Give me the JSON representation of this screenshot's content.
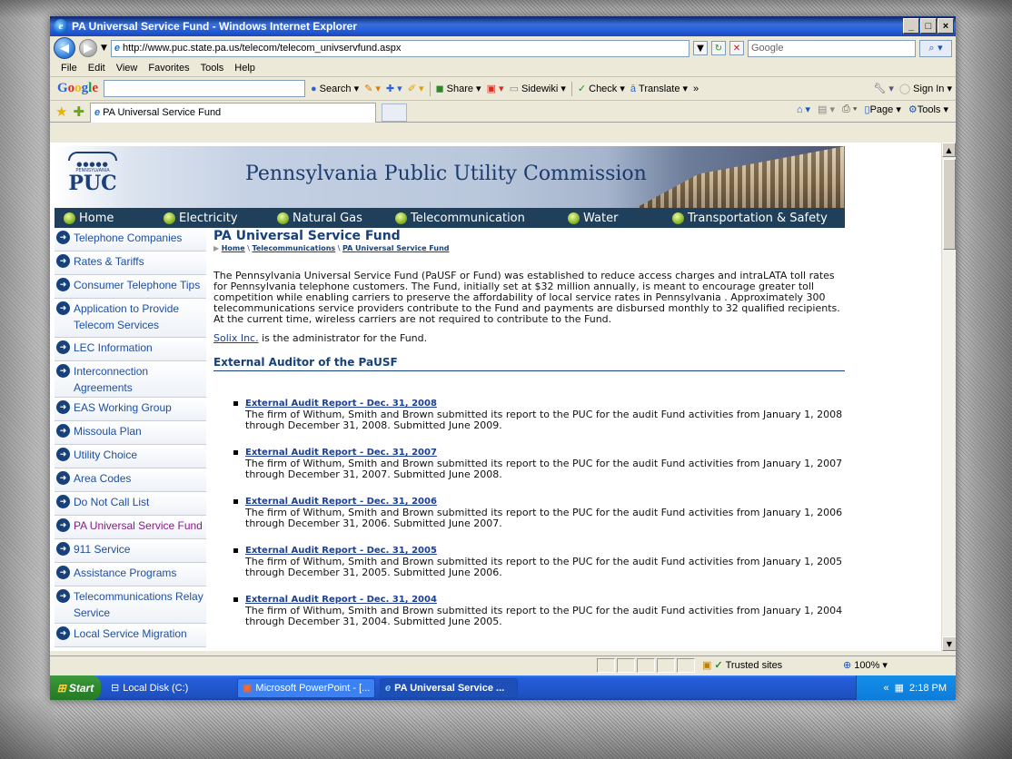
{
  "window": {
    "title": "PA Universal Service Fund - Windows Internet Explorer",
    "controls": [
      "_",
      "□",
      "×"
    ]
  },
  "address_bar": {
    "url": "http://www.puc.state.pa.us/telecom/telecom_univservfund.aspx",
    "search_placeholder": "Google"
  },
  "menu": [
    "File",
    "Edit",
    "View",
    "Favorites",
    "Tools",
    "Help"
  ],
  "google_toolbar": {
    "logo": "Google",
    "items": [
      "Search ▾",
      "Share ▾",
      "Sidewiki ▾",
      "Check ▾",
      "Translate ▾",
      "»"
    ],
    "sign_in": "Sign In ▾"
  },
  "tab": {
    "title": "PA Universal Service Fund",
    "tools": [
      "Page ▾",
      "Tools ▾"
    ]
  },
  "site": {
    "title": "Pennsylvania Public Utility Commission",
    "logo_text": "PUC",
    "logo_state": "PENNSYLVANIA"
  },
  "topnav": [
    "Home",
    "Electricity",
    "Natural Gas",
    "Telecommunication",
    "Water",
    "Transportation & Safety"
  ],
  "sidebar": [
    {
      "label": "Telephone Companies",
      "active": false
    },
    {
      "label": "Rates & Tariffs",
      "active": false
    },
    {
      "label": "Consumer Telephone Tips",
      "active": false
    },
    {
      "label": "Application to Provide Telecom Services",
      "active": false
    },
    {
      "label": "LEC Information",
      "active": false
    },
    {
      "label": "Interconnection Agreements",
      "active": false
    },
    {
      "label": "EAS Working Group",
      "active": false
    },
    {
      "label": "Missoula Plan",
      "active": false
    },
    {
      "label": "Utility Choice",
      "active": false
    },
    {
      "label": "Area Codes",
      "active": false
    },
    {
      "label": "Do Not Call List",
      "active": false
    },
    {
      "label": "PA Universal Service Fund",
      "active": true
    },
    {
      "label": "911 Service",
      "active": false
    },
    {
      "label": "Assistance Programs",
      "active": false
    },
    {
      "label": "Telecommunications Relay Service",
      "active": false
    },
    {
      "label": "Local Service Migration",
      "active": false
    }
  ],
  "main": {
    "heading": "PA Universal Service Fund",
    "breadcrumb": [
      "Home",
      "Telecommunications",
      "PA Universal Service Fund"
    ],
    "intro": "The Pennsylvania Universal Service Fund (PaUSF or Fund) was established to reduce access charges and intraLATA toll rates for Pennsylvania telephone customers. The Fund, initially set at $32 million annually, is meant to encourage greater toll competition while enabling carriers to preserve the affordability of local service rates in Pennsylvania . Approximately 300 telecommunications service providers contribute to the Fund and payments are disbursed monthly to 32 qualified recipients. At the current time, wireless carriers are not required to contribute to the Fund.",
    "admin_link": "Solix Inc.",
    "admin_text": " is the administrator for the Fund.",
    "section_heading": "External Auditor of the PaUSF",
    "reports": [
      {
        "title": "External Audit Report - Dec. 31, 2008",
        "text": "The firm of Withum, Smith and Brown submitted its report to the PUC for the audit Fund activities from January 1, 2008 through December 31, 2008. Submitted June 2009."
      },
      {
        "title": "External Audit Report - Dec. 31, 2007",
        "text": "The firm of Withum, Smith and Brown submitted its report to the PUC for the audit Fund activities from January 1, 2007 through December 31, 2007. Submitted June 2008."
      },
      {
        "title": "External Audit Report - Dec. 31, 2006",
        "text": "The firm of Withum, Smith and Brown submitted its report to the PUC for the audit Fund activities from January 1, 2006 through December 31, 2006. Submitted June 2007."
      },
      {
        "title": "External Audit Report - Dec. 31, 2005",
        "text": "The firm of Withum, Smith and Brown submitted its report to the PUC for the audit Fund activities from January 1, 2005 through December 31, 2005. Submitted June 2006."
      },
      {
        "title": "External Audit Report - Dec. 31, 2004",
        "text": "The firm of Withum, Smith and Brown submitted its report to the PUC for the audit Fund activities from January 1, 2004 through December 31, 2004. Submitted June 2005."
      }
    ]
  },
  "status": {
    "zone": "Trusted sites",
    "zoom": "100%"
  },
  "taskbar": {
    "start": "Start",
    "tasks": [
      "Local Disk (C:)",
      "Microsoft PowerPoint - [...",
      "PA Universal Service ..."
    ],
    "clock": "2:18 PM"
  },
  "colors": {
    "nav_bg": "#1f3f5a",
    "link": "#1d4ea3",
    "heading": "#17417a",
    "active_side": "#8a1a8a"
  }
}
